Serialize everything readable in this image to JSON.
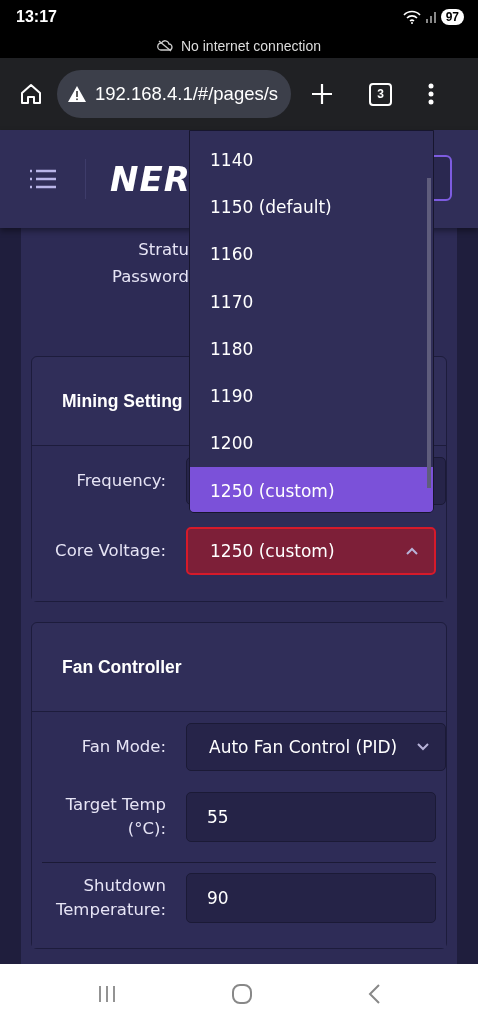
{
  "status_bar": {
    "time": "13:17",
    "battery": "97"
  },
  "offline_banner": "No internet connection",
  "browser": {
    "url": "192.168.4.1/#/pages/s",
    "tab_count": "3"
  },
  "header": {
    "logo": "NER"
  },
  "stratum_password_label": [
    "Stratu",
    "Password"
  ],
  "cards": [
    {
      "title": "Mining Setting",
      "fields": [
        {
          "kind": "select",
          "label": "Frequency:",
          "separated": false
        },
        {
          "kind": "select",
          "label": "Core Voltage:",
          "value": "1250 (custom)",
          "expanded": true,
          "invalid": true,
          "separated": false
        }
      ]
    },
    {
      "title": "Fan Controller",
      "fields": [
        {
          "kind": "select",
          "label": "Fan Mode:",
          "value": "Auto Fan Control (PID)",
          "expanded": false,
          "invalid": false,
          "separated": false
        },
        {
          "kind": "input",
          "label": "Target Temp (°C):",
          "value": "55",
          "separated": false
        },
        {
          "kind": "input",
          "label": "Shutdown Temperature:",
          "value": "90",
          "separated": true
        }
      ]
    }
  ],
  "dropdown": {
    "options": [
      {
        "label": "1140",
        "selected": false
      },
      {
        "label": "1150 (default)",
        "selected": false
      },
      {
        "label": "1160",
        "selected": false
      },
      {
        "label": "1170",
        "selected": false
      },
      {
        "label": "1180",
        "selected": false
      },
      {
        "label": "1190",
        "selected": false
      },
      {
        "label": "1200",
        "selected": false
      },
      {
        "label": "1250 (custom)",
        "selected": true
      }
    ]
  }
}
